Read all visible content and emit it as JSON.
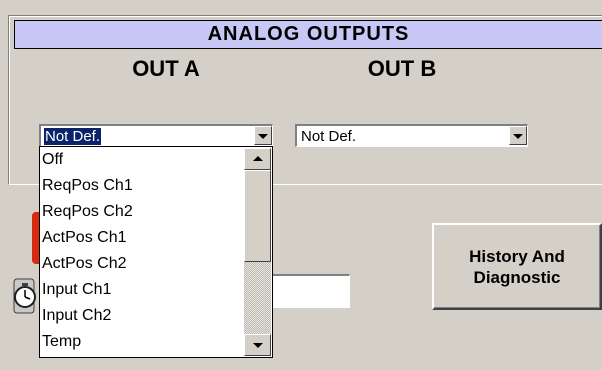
{
  "analog_outputs": {
    "title": "ANALOG OUTPUTS",
    "out_a": {
      "label": "OUT A",
      "selected_value": "Not Def.",
      "open": true
    },
    "out_b": {
      "label": "OUT B",
      "selected_value": "Not Def."
    }
  },
  "dropdown_options": [
    "Off",
    "ReqPos Ch1",
    "ReqPos Ch2",
    "ActPos Ch1",
    "ActPos Ch2",
    "Input Ch1",
    "Input Ch2",
    "Temp"
  ],
  "buttons": {
    "history_line1": "History And",
    "history_line2": "Diagnostic"
  },
  "icons": {
    "thermometer": "thermometer-icon",
    "stopwatch": "stopwatch-icon"
  },
  "colors": {
    "title_background": "#c8c8f6",
    "selection": "#0a246a",
    "window_face": "#d4d0c8",
    "thermometer_red": "#d42a10"
  }
}
